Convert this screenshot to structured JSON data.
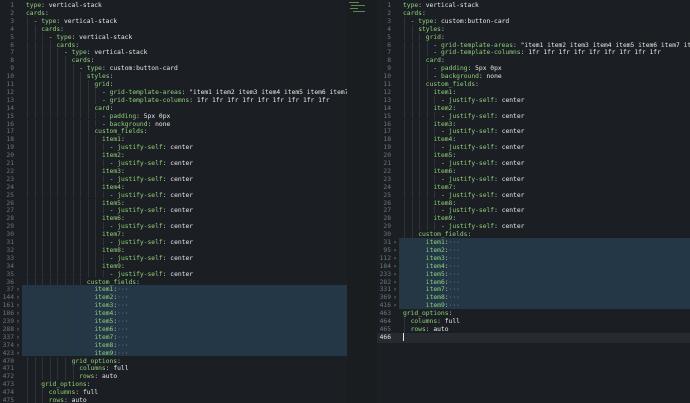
{
  "left": [
    {
      "ln": "1",
      "indent": 0,
      "dash": false,
      "key": "type",
      "sep": ": ",
      "value": "vertical-stack"
    },
    {
      "ln": "2",
      "indent": 0,
      "dash": false,
      "key": "cards",
      "sep": ":",
      "value": ""
    },
    {
      "ln": "3",
      "indent": 1,
      "dash": true,
      "key": "type",
      "sep": ": ",
      "value": "vertical-stack"
    },
    {
      "ln": "4",
      "indent": 2,
      "dash": false,
      "key": "cards",
      "sep": ":",
      "value": ""
    },
    {
      "ln": "5",
      "indent": 3,
      "dash": true,
      "key": "type",
      "sep": ": ",
      "value": "vertical-stack"
    },
    {
      "ln": "6",
      "indent": 4,
      "dash": false,
      "key": "cards",
      "sep": ":",
      "value": ""
    },
    {
      "ln": "7",
      "indent": 5,
      "dash": true,
      "key": "type",
      "sep": ": ",
      "value": "vertical-stack"
    },
    {
      "ln": "8",
      "indent": 6,
      "dash": false,
      "key": "cards",
      "sep": ":",
      "value": ""
    },
    {
      "ln": "9",
      "indent": 7,
      "dash": true,
      "key": "type",
      "sep": ": ",
      "value": "custom:button-card"
    },
    {
      "ln": "10",
      "indent": 8,
      "dash": false,
      "key": "styles",
      "sep": ":",
      "value": ""
    },
    {
      "ln": "11",
      "indent": 9,
      "dash": false,
      "key": "grid",
      "sep": ":",
      "value": ""
    },
    {
      "ln": "12",
      "indent": 10,
      "dash": true,
      "key": "grid-template-areas",
      "sep": ": ",
      "value": "\"item1 item2 item3 item4 item5 item6 item7 item8 item9\""
    },
    {
      "ln": "13",
      "indent": 10,
      "dash": true,
      "key": "grid-template-columns",
      "sep": ": ",
      "value": "1fr 1fr 1fr 1fr 1fr 1fr 1fr 1fr 1fr"
    },
    {
      "ln": "14",
      "indent": 9,
      "dash": false,
      "key": "card",
      "sep": ":",
      "value": ""
    },
    {
      "ln": "15",
      "indent": 10,
      "dash": true,
      "key": "padding",
      "sep": ": ",
      "value": "5px 0px"
    },
    {
      "ln": "16",
      "indent": 10,
      "dash": true,
      "key": "background",
      "sep": ": ",
      "value": "none"
    },
    {
      "ln": "17",
      "indent": 9,
      "dash": false,
      "key": "custom_fields",
      "sep": ":",
      "value": ""
    },
    {
      "ln": "18",
      "indent": 10,
      "dash": false,
      "key": "item1",
      "sep": ":",
      "value": ""
    },
    {
      "ln": "19",
      "indent": 11,
      "dash": true,
      "key": "justify-self",
      "sep": ": ",
      "value": "center"
    },
    {
      "ln": "20",
      "indent": 10,
      "dash": false,
      "key": "item2",
      "sep": ":",
      "value": ""
    },
    {
      "ln": "21",
      "indent": 11,
      "dash": true,
      "key": "justify-self",
      "sep": ": ",
      "value": "center"
    },
    {
      "ln": "22",
      "indent": 10,
      "dash": false,
      "key": "item3",
      "sep": ":",
      "value": ""
    },
    {
      "ln": "23",
      "indent": 11,
      "dash": true,
      "key": "justify-self",
      "sep": ": ",
      "value": "center"
    },
    {
      "ln": "24",
      "indent": 10,
      "dash": false,
      "key": "item4",
      "sep": ":",
      "value": ""
    },
    {
      "ln": "25",
      "indent": 11,
      "dash": true,
      "key": "justify-self",
      "sep": ": ",
      "value": "center"
    },
    {
      "ln": "26",
      "indent": 10,
      "dash": false,
      "key": "item5",
      "sep": ":",
      "value": ""
    },
    {
      "ln": "27",
      "indent": 11,
      "dash": true,
      "key": "justify-self",
      "sep": ": ",
      "value": "center"
    },
    {
      "ln": "28",
      "indent": 10,
      "dash": false,
      "key": "item6",
      "sep": ":",
      "value": ""
    },
    {
      "ln": "29",
      "indent": 11,
      "dash": true,
      "key": "justify-self",
      "sep": ": ",
      "value": "center"
    },
    {
      "ln": "30",
      "indent": 10,
      "dash": false,
      "key": "item7",
      "sep": ":",
      "value": ""
    },
    {
      "ln": "31",
      "indent": 11,
      "dash": true,
      "key": "justify-self",
      "sep": ": ",
      "value": "center"
    },
    {
      "ln": "32",
      "indent": 10,
      "dash": false,
      "key": "item8",
      "sep": ":",
      "value": ""
    },
    {
      "ln": "33",
      "indent": 11,
      "dash": true,
      "key": "justify-self",
      "sep": ": ",
      "value": "center"
    },
    {
      "ln": "34",
      "indent": 10,
      "dash": false,
      "key": "item9",
      "sep": ":",
      "value": ""
    },
    {
      "ln": "35",
      "indent": 11,
      "dash": true,
      "key": "justify-self",
      "sep": ": ",
      "value": "center"
    },
    {
      "ln": "36",
      "indent": 8,
      "dash": false,
      "key": "custom_fields",
      "sep": ":",
      "value": ""
    },
    {
      "ln": "37",
      "indent": 9,
      "dash": false,
      "key": "item1",
      "sep": ":",
      "value": "",
      "fold": "›",
      "ell": "···",
      "hl": true
    },
    {
      "ln": "144",
      "indent": 9,
      "dash": false,
      "key": "item2",
      "sep": ":",
      "value": "",
      "fold": "›",
      "ell": "···",
      "hl": true
    },
    {
      "ln": "161",
      "indent": 9,
      "dash": false,
      "key": "item3",
      "sep": ":",
      "value": "",
      "fold": "›",
      "ell": "···",
      "hl": true
    },
    {
      "ln": "186",
      "indent": 9,
      "dash": false,
      "key": "item4",
      "sep": ":",
      "value": "",
      "fold": "›",
      "ell": "···",
      "hl": true
    },
    {
      "ln": "239",
      "indent": 9,
      "dash": false,
      "key": "item5",
      "sep": ":",
      "value": "",
      "fold": "›",
      "ell": "···",
      "hl": true
    },
    {
      "ln": "288",
      "indent": 9,
      "dash": false,
      "key": "item6",
      "sep": ":",
      "value": "",
      "fold": "›",
      "ell": "···",
      "hl": true
    },
    {
      "ln": "337",
      "indent": 9,
      "dash": false,
      "key": "item7",
      "sep": ":",
      "value": "",
      "fold": "›",
      "ell": "···",
      "hl": true
    },
    {
      "ln": "374",
      "indent": 9,
      "dash": false,
      "key": "item8",
      "sep": ":",
      "value": "",
      "fold": "›",
      "ell": "···",
      "hl": true
    },
    {
      "ln": "423",
      "indent": 9,
      "dash": false,
      "key": "item9",
      "sep": ":",
      "value": "",
      "fold": "›",
      "ell": "···",
      "hl": true
    },
    {
      "ln": "470",
      "indent": 6,
      "dash": false,
      "key": "grid_options",
      "sep": ":",
      "value": ""
    },
    {
      "ln": "471",
      "indent": 7,
      "dash": false,
      "key": "columns",
      "sep": ": ",
      "value": "full"
    },
    {
      "ln": "472",
      "indent": 7,
      "dash": false,
      "key": "rows",
      "sep": ": ",
      "value": "auto"
    },
    {
      "ln": "473",
      "indent": 2,
      "dash": false,
      "key": "grid_options",
      "sep": ":",
      "value": ""
    },
    {
      "ln": "474",
      "indent": 3,
      "dash": false,
      "key": "columns",
      "sep": ": ",
      "value": "full"
    },
    {
      "ln": "475",
      "indent": 3,
      "dash": false,
      "key": "rows",
      "sep": ": ",
      "value": "auto"
    },
    {
      "ln": "476",
      "indent": 0,
      "dash": false,
      "key": "",
      "sep": "",
      "value": "",
      "current": true
    }
  ],
  "right": [
    {
      "ln": "1",
      "indent": 0,
      "dash": false,
      "key": "type",
      "sep": ": ",
      "value": "vertical-stack"
    },
    {
      "ln": "2",
      "indent": 0,
      "dash": false,
      "key": "cards",
      "sep": ":",
      "value": ""
    },
    {
      "ln": "3",
      "indent": 1,
      "dash": true,
      "key": "type",
      "sep": ": ",
      "value": "custom:button-card"
    },
    {
      "ln": "4",
      "indent": 2,
      "dash": false,
      "key": "styles",
      "sep": ":",
      "value": ""
    },
    {
      "ln": "5",
      "indent": 3,
      "dash": false,
      "key": "grid",
      "sep": ":",
      "value": ""
    },
    {
      "ln": "6",
      "indent": 4,
      "dash": true,
      "key": "grid-template-areas",
      "sep": ": ",
      "value": "\"item1 item2 item3 item4 item5 item6 item7 item8 item9\""
    },
    {
      "ln": "7",
      "indent": 4,
      "dash": true,
      "key": "grid-template-columns",
      "sep": ": ",
      "value": "1fr 1fr 1fr 1fr 1fr 1fr 1fr 1fr 1fr"
    },
    {
      "ln": "8",
      "indent": 3,
      "dash": false,
      "key": "card",
      "sep": ":",
      "value": ""
    },
    {
      "ln": "9",
      "indent": 4,
      "dash": true,
      "key": "padding",
      "sep": ": ",
      "value": "5px 0px"
    },
    {
      "ln": "10",
      "indent": 4,
      "dash": true,
      "key": "background",
      "sep": ": ",
      "value": "none"
    },
    {
      "ln": "11",
      "indent": 3,
      "dash": false,
      "key": "custom_fields",
      "sep": ":",
      "value": ""
    },
    {
      "ln": "12",
      "indent": 4,
      "dash": false,
      "key": "item1",
      "sep": ":",
      "value": ""
    },
    {
      "ln": "13",
      "indent": 5,
      "dash": true,
      "key": "justify-self",
      "sep": ": ",
      "value": "center"
    },
    {
      "ln": "14",
      "indent": 4,
      "dash": false,
      "key": "item2",
      "sep": ":",
      "value": ""
    },
    {
      "ln": "15",
      "indent": 5,
      "dash": true,
      "key": "justify-self",
      "sep": ": ",
      "value": "center"
    },
    {
      "ln": "16",
      "indent": 4,
      "dash": false,
      "key": "item3",
      "sep": ":",
      "value": ""
    },
    {
      "ln": "17",
      "indent": 5,
      "dash": true,
      "key": "justify-self",
      "sep": ": ",
      "value": "center"
    },
    {
      "ln": "18",
      "indent": 4,
      "dash": false,
      "key": "item4",
      "sep": ":",
      "value": ""
    },
    {
      "ln": "19",
      "indent": 5,
      "dash": true,
      "key": "justify-self",
      "sep": ": ",
      "value": "center"
    },
    {
      "ln": "20",
      "indent": 4,
      "dash": false,
      "key": "item5",
      "sep": ":",
      "value": ""
    },
    {
      "ln": "21",
      "indent": 5,
      "dash": true,
      "key": "justify-self",
      "sep": ": ",
      "value": "center"
    },
    {
      "ln": "22",
      "indent": 4,
      "dash": false,
      "key": "item6",
      "sep": ":",
      "value": ""
    },
    {
      "ln": "23",
      "indent": 5,
      "dash": true,
      "key": "justify-self",
      "sep": ": ",
      "value": "center"
    },
    {
      "ln": "24",
      "indent": 4,
      "dash": false,
      "key": "item7",
      "sep": ":",
      "value": ""
    },
    {
      "ln": "25",
      "indent": 5,
      "dash": true,
      "key": "justify-self",
      "sep": ": ",
      "value": "center"
    },
    {
      "ln": "26",
      "indent": 4,
      "dash": false,
      "key": "item8",
      "sep": ":",
      "value": ""
    },
    {
      "ln": "27",
      "indent": 5,
      "dash": true,
      "key": "justify-self",
      "sep": ": ",
      "value": "center"
    },
    {
      "ln": "28",
      "indent": 4,
      "dash": false,
      "key": "item9",
      "sep": ":",
      "value": ""
    },
    {
      "ln": "29",
      "indent": 5,
      "dash": true,
      "key": "justify-self",
      "sep": ": ",
      "value": "center"
    },
    {
      "ln": "30",
      "indent": 2,
      "dash": false,
      "key": "custom_fields",
      "sep": ":",
      "value": ""
    },
    {
      "ln": "31",
      "indent": 3,
      "dash": false,
      "key": "item1",
      "sep": ":",
      "value": "",
      "fold": "›",
      "ell": "···",
      "hl": true
    },
    {
      "ln": "95",
      "indent": 3,
      "dash": false,
      "key": "item2",
      "sep": ":",
      "value": "",
      "fold": "›",
      "ell": "···",
      "hl": true
    },
    {
      "ln": "112",
      "indent": 3,
      "dash": false,
      "key": "item3",
      "sep": ":",
      "value": "",
      "fold": "›",
      "ell": "···",
      "hl": true
    },
    {
      "ln": "184",
      "indent": 3,
      "dash": false,
      "key": "item4",
      "sep": ":",
      "value": "",
      "fold": "›",
      "ell": "···",
      "hl": true
    },
    {
      "ln": "233",
      "indent": 3,
      "dash": false,
      "key": "item5",
      "sep": ":",
      "value": "",
      "fold": "›",
      "ell": "···",
      "hl": true
    },
    {
      "ln": "282",
      "indent": 3,
      "dash": false,
      "key": "item6",
      "sep": ":",
      "value": "",
      "fold": "›",
      "ell": "···",
      "hl": true
    },
    {
      "ln": "331",
      "indent": 3,
      "dash": false,
      "key": "item7",
      "sep": ":",
      "value": "",
      "fold": "›",
      "ell": "···",
      "hl": true
    },
    {
      "ln": "369",
      "indent": 3,
      "dash": false,
      "key": "item8",
      "sep": ":",
      "value": "",
      "fold": "›",
      "ell": "···",
      "hl": true
    },
    {
      "ln": "416",
      "indent": 3,
      "dash": false,
      "key": "item9",
      "sep": ":",
      "value": "",
      "fold": "›",
      "ell": "···",
      "hl": true
    },
    {
      "ln": "463",
      "indent": 0,
      "dash": false,
      "key": "grid_options",
      "sep": ":",
      "value": ""
    },
    {
      "ln": "464",
      "indent": 1,
      "dash": false,
      "key": "columns",
      "sep": ": ",
      "value": "full"
    },
    {
      "ln": "465",
      "indent": 1,
      "dash": false,
      "key": "rows",
      "sep": ": ",
      "value": "auto"
    },
    {
      "ln": "466",
      "indent": 0,
      "dash": false,
      "key": "",
      "sep": "",
      "value": "",
      "current": true
    }
  ],
  "colors": {
    "background": "#1b1f23",
    "key": "#8fd17a",
    "value": "#e8eaeb",
    "line_number": "#6c7680",
    "fold_highlight": "#243746"
  }
}
